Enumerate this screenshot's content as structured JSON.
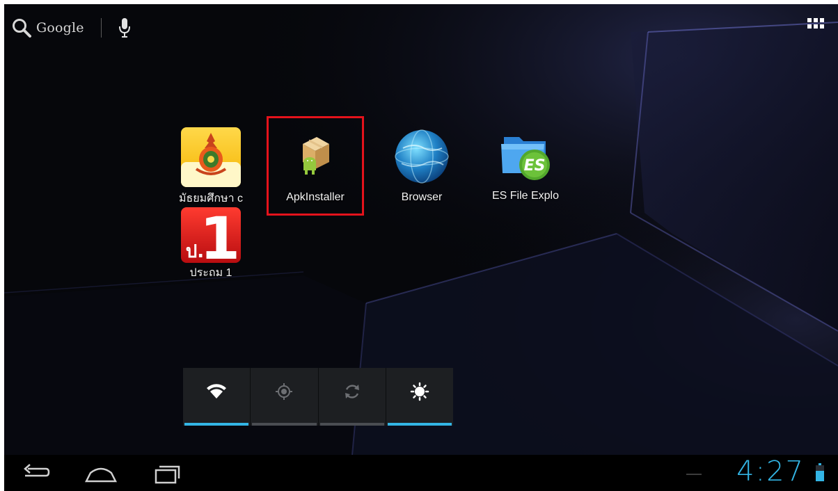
{
  "search": {
    "label": "Google"
  },
  "apps": [
    {
      "label": "มัธยมศึกษา c",
      "icon": "school-emblem-icon"
    },
    {
      "label": "ApkInstaller",
      "icon": "package-android-icon"
    },
    {
      "label": "Browser",
      "icon": "globe-icon"
    },
    {
      "label": "ES File Explo",
      "icon": "es-folder-icon"
    },
    {
      "label": "ประถม 1",
      "icon": "grade1-icon"
    }
  ],
  "power_widget": [
    {
      "name": "wifi",
      "state": "on"
    },
    {
      "name": "gps",
      "state": "off"
    },
    {
      "name": "sync",
      "state": "off"
    },
    {
      "name": "brightness",
      "state": "on"
    }
  ],
  "system_bar": {
    "time": "4:27"
  },
  "colors": {
    "accent": "#33b5e5",
    "highlight": "#e4121b",
    "background": "#06070b"
  }
}
